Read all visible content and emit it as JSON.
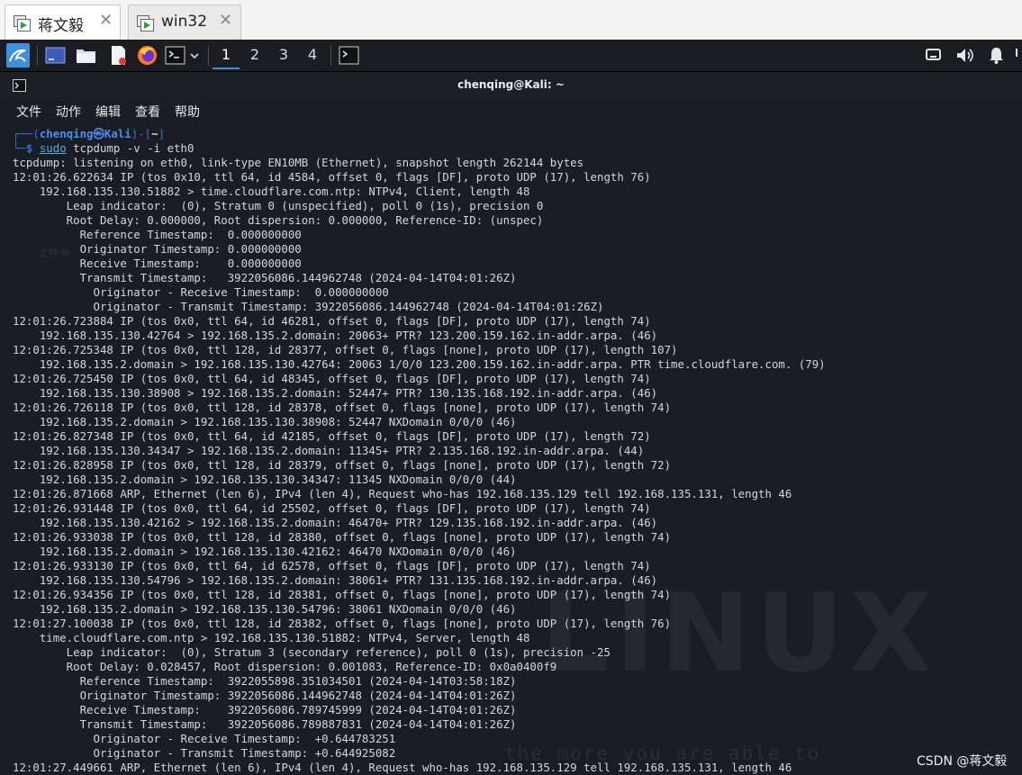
{
  "tabs": [
    {
      "label": "蒋文毅",
      "close": "✕",
      "active": true,
      "icon": "vm-icon"
    },
    {
      "label": "win32",
      "close": "✕",
      "active": false,
      "icon": "vm-icon"
    }
  ],
  "panel": {
    "workspaces": [
      "1",
      "2",
      "3",
      "4"
    ],
    "active_workspace": "1",
    "accent_color": "#3f8fe0"
  },
  "window": {
    "title": "chenqing@Kali: ~"
  },
  "menu": [
    "文件",
    "动作",
    "编辑",
    "查看",
    "帮助"
  ],
  "prompt": {
    "box_top_left": "┌──(",
    "user": "chenqing㉿Kali",
    "box_mid": ")-[",
    "dir": "~",
    "box_end": "]",
    "box_bottom": "└─",
    "dollar": "$ ",
    "sudo": "sudo",
    "command": " tcpdump -v -i eth0"
  },
  "output": [
    "tcpdump: listening on eth0, link-type EN10MB (Ethernet), snapshot length 262144 bytes",
    "12:01:26.622634 IP (tos 0x10, ttl 64, id 4584, offset 0, flags [DF], proto UDP (17), length 76)",
    "    192.168.135.130.51882 > time.cloudflare.com.ntp: NTPv4, Client, length 48",
    "        Leap indicator:  (0), Stratum 0 (unspecified), poll 0 (1s), precision 0",
    "        Root Delay: 0.000000, Root dispersion: 0.000000, Reference-ID: (unspec)",
    "          Reference Timestamp:  0.000000000",
    "          Originator Timestamp: 0.000000000",
    "          Receive Timestamp:    0.000000000",
    "          Transmit Timestamp:   3922056086.144962748 (2024-04-14T04:01:26Z)",
    "            Originator - Receive Timestamp:  0.000000000",
    "            Originator - Transmit Timestamp: 3922056086.144962748 (2024-04-14T04:01:26Z)",
    "12:01:26.723884 IP (tos 0x0, ttl 64, id 46281, offset 0, flags [DF], proto UDP (17), length 74)",
    "    192.168.135.130.42764 > 192.168.135.2.domain: 20063+ PTR? 123.200.159.162.in-addr.arpa. (46)",
    "12:01:26.725348 IP (tos 0x0, ttl 128, id 28377, offset 0, flags [none], proto UDP (17), length 107)",
    "    192.168.135.2.domain > 192.168.135.130.42764: 20063 1/0/0 123.200.159.162.in-addr.arpa. PTR time.cloudflare.com. (79)",
    "12:01:26.725450 IP (tos 0x0, ttl 64, id 48345, offset 0, flags [DF], proto UDP (17), length 74)",
    "    192.168.135.130.38908 > 192.168.135.2.domain: 52447+ PTR? 130.135.168.192.in-addr.arpa. (46)",
    "12:01:26.726118 IP (tos 0x0, ttl 128, id 28378, offset 0, flags [none], proto UDP (17), length 74)",
    "    192.168.135.2.domain > 192.168.135.130.38908: 52447 NXDomain 0/0/0 (46)",
    "12:01:26.827348 IP (tos 0x0, ttl 64, id 42185, offset 0, flags [DF], proto UDP (17), length 72)",
    "    192.168.135.130.34347 > 192.168.135.2.domain: 11345+ PTR? 2.135.168.192.in-addr.arpa. (44)",
    "12:01:26.828958 IP (tos 0x0, ttl 128, id 28379, offset 0, flags [none], proto UDP (17), length 72)",
    "    192.168.135.2.domain > 192.168.135.130.34347: 11345 NXDomain 0/0/0 (44)",
    "12:01:26.871668 ARP, Ethernet (len 6), IPv4 (len 4), Request who-has 192.168.135.129 tell 192.168.135.131, length 46",
    "12:01:26.931448 IP (tos 0x0, ttl 64, id 25502, offset 0, flags [DF], proto UDP (17), length 74)",
    "    192.168.135.130.42162 > 192.168.135.2.domain: 46470+ PTR? 129.135.168.192.in-addr.arpa. (46)",
    "12:01:26.933038 IP (tos 0x0, ttl 128, id 28380, offset 0, flags [none], proto UDP (17), length 74)",
    "    192.168.135.2.domain > 192.168.135.130.42162: 46470 NXDomain 0/0/0 (46)",
    "12:01:26.933130 IP (tos 0x0, ttl 64, id 62578, offset 0, flags [DF], proto UDP (17), length 74)",
    "    192.168.135.130.54796 > 192.168.135.2.domain: 38061+ PTR? 131.135.168.192.in-addr.arpa. (46)",
    "12:01:26.934356 IP (tos 0x0, ttl 128, id 28381, offset 0, flags [none], proto UDP (17), length 74)",
    "    192.168.135.2.domain > 192.168.135.130.54796: 38061 NXDomain 0/0/0 (46)",
    "12:01:27.100038 IP (tos 0x0, ttl 128, id 28382, offset 0, flags [none], proto UDP (17), length 76)",
    "    time.cloudflare.com.ntp > 192.168.135.130.51882: NTPv4, Server, length 48",
    "        Leap indicator:  (0), Stratum 3 (secondary reference), poll 0 (1s), precision -25",
    "        Root Delay: 0.028457, Root dispersion: 0.001083, Reference-ID: 0x0a0400f9",
    "          Reference Timestamp:  3922055898.351034501 (2024-04-14T03:58:18Z)",
    "          Originator Timestamp: 3922056086.144962748 (2024-04-14T04:01:26Z)",
    "          Receive Timestamp:    3922056086.789745999 (2024-04-14T04:01:26Z)",
    "          Transmit Timestamp:   3922056086.789887831 (2024-04-14T04:01:26Z)",
    "            Originator - Receive Timestamp:  +0.644783251",
    "            Originator - Transmit Timestamp: +0.644925082",
    "12:01:27.449661 ARP, Ethernet (len 6), IPv4 (len 4), Request who-has 192.168.135.129 tell 192.168.135.131, length 46"
  ],
  "watermark": "CSDN @蒋文毅"
}
